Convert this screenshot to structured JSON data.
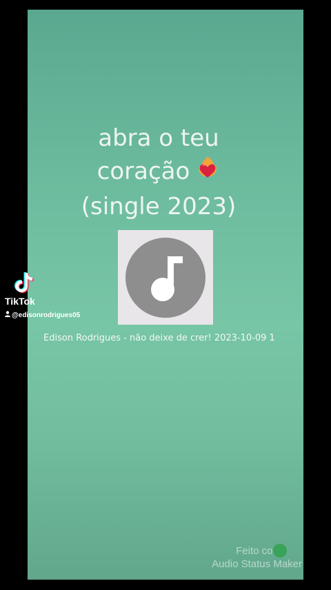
{
  "video": {
    "title_lines": [
      "abra o teu",
      "coração",
      "(single 2023)"
    ],
    "title_emoji": "heart-on-fire-icon",
    "cover_icon": "music-note-icon",
    "caption": "Edison Rodrigues - não deixe de crer! 2023-10-09 1"
  },
  "watermark": {
    "brand": "TikTok",
    "handle": "@edisonrodrigues05",
    "logo_icon": "tiktok-logo-icon",
    "user_icon": "user-icon"
  },
  "maker": {
    "line1": "Feito com",
    "line2": "Audio Status Maker",
    "badge_icon": "app-badge-icon"
  },
  "colors": {
    "background": "#000000",
    "panel": "#72bd9e",
    "text": "#eef5f1",
    "cover": "#e9e6ea",
    "disc": "#8e8e8e"
  }
}
